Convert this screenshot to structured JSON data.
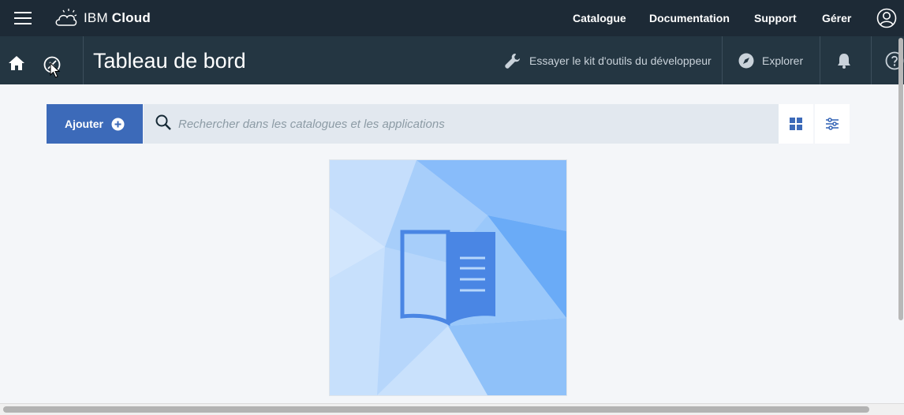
{
  "topbar": {
    "brand_prefix": "IBM",
    "brand_suffix": "Cloud",
    "nav": [
      {
        "label": "Catalogue"
      },
      {
        "label": "Documentation"
      },
      {
        "label": "Support"
      },
      {
        "label": "Gérer"
      }
    ],
    "icons": [
      "menu-icon",
      "cloud-logo-icon",
      "user-avatar-icon"
    ]
  },
  "subbar": {
    "title": "Tableau de bord",
    "dev_kit_label": "Essayer le kit d'outils du développeur",
    "explore_label": "Explorer",
    "icons": [
      "home-icon",
      "pin-icon",
      "wrench-icon",
      "compass-icon",
      "bell-icon",
      "help-icon"
    ]
  },
  "toolbar": {
    "add_label": "Ajouter",
    "search_placeholder": "Rechercher dans les catalogues et les applications",
    "icons": [
      "plus-circle-icon",
      "search-icon",
      "grid-view-icon",
      "filter-settings-icon"
    ]
  },
  "card": {
    "icon": "open-book-icon"
  },
  "colors": {
    "topbar_bg": "#1d2a36",
    "subbar_bg": "#243642",
    "accent": "#3c6ab9",
    "page_bg": "#f4f6f9"
  }
}
